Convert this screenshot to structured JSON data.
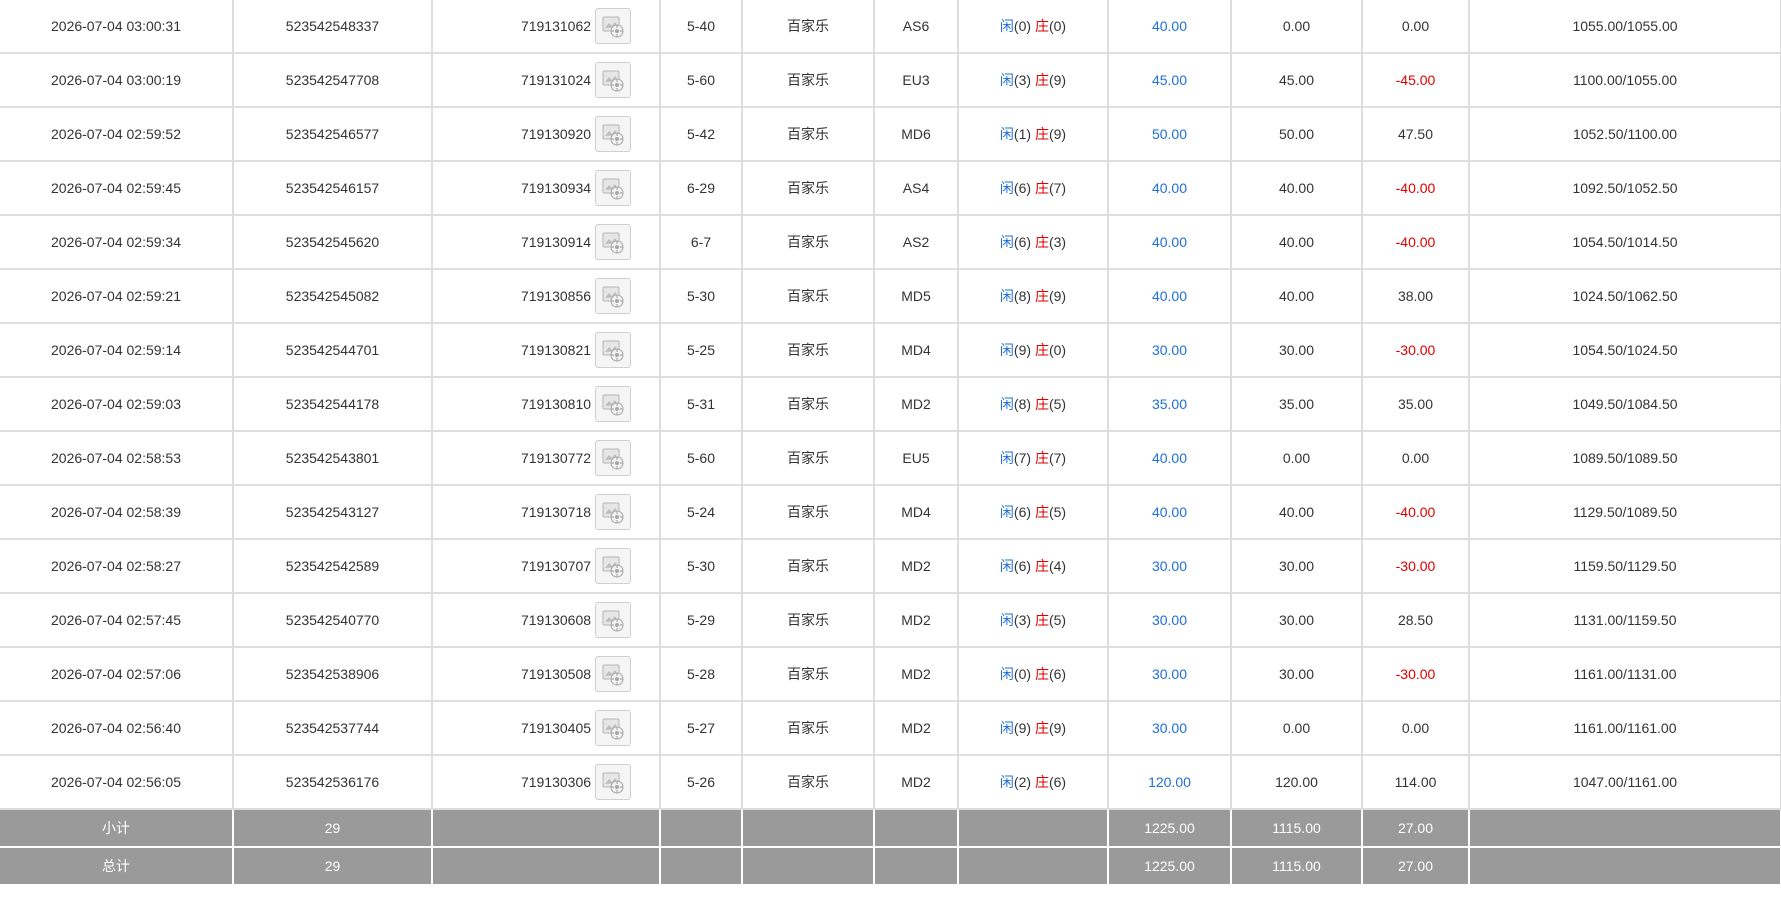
{
  "icons": {
    "row_thumb": "game-replay-image-icon"
  },
  "colors": {
    "blue": "#1e6fd9",
    "red": "#e00000",
    "summary_bg": "#9a9a9a",
    "grid": "#dddddd"
  },
  "rows": [
    {
      "time": "2026-07-04 03:00:31",
      "bet_id": "523542548337",
      "round": "719131062",
      "shoe": "5-40",
      "game": "百家乐",
      "table": "AS6",
      "player_label": "闲",
      "player_pts": "(0)",
      "banker_label": "庄",
      "banker_pts": "(0)",
      "bet": "40.00",
      "valid": "0.00",
      "win": "0.00",
      "win_neg": false,
      "balance": "1055.00/1055.00"
    },
    {
      "time": "2026-07-04 03:00:19",
      "bet_id": "523542547708",
      "round": "719131024",
      "shoe": "5-60",
      "game": "百家乐",
      "table": "EU3",
      "player_label": "闲",
      "player_pts": "(3)",
      "banker_label": "庄",
      "banker_pts": "(9)",
      "bet": "45.00",
      "valid": "45.00",
      "win": "-45.00",
      "win_neg": true,
      "balance": "1100.00/1055.00"
    },
    {
      "time": "2026-07-04 02:59:52",
      "bet_id": "523542546577",
      "round": "719130920",
      "shoe": "5-42",
      "game": "百家乐",
      "table": "MD6",
      "player_label": "闲",
      "player_pts": "(1)",
      "banker_label": "庄",
      "banker_pts": "(9)",
      "bet": "50.00",
      "valid": "50.00",
      "win": "47.50",
      "win_neg": false,
      "balance": "1052.50/1100.00"
    },
    {
      "time": "2026-07-04 02:59:45",
      "bet_id": "523542546157",
      "round": "719130934",
      "shoe": "6-29",
      "game": "百家乐",
      "table": "AS4",
      "player_label": "闲",
      "player_pts": "(6)",
      "banker_label": "庄",
      "banker_pts": "(7)",
      "bet": "40.00",
      "valid": "40.00",
      "win": "-40.00",
      "win_neg": true,
      "balance": "1092.50/1052.50"
    },
    {
      "time": "2026-07-04 02:59:34",
      "bet_id": "523542545620",
      "round": "719130914",
      "shoe": "6-7",
      "game": "百家乐",
      "table": "AS2",
      "player_label": "闲",
      "player_pts": "(6)",
      "banker_label": "庄",
      "banker_pts": "(3)",
      "bet": "40.00",
      "valid": "40.00",
      "win": "-40.00",
      "win_neg": true,
      "balance": "1054.50/1014.50"
    },
    {
      "time": "2026-07-04 02:59:21",
      "bet_id": "523542545082",
      "round": "719130856",
      "shoe": "5-30",
      "game": "百家乐",
      "table": "MD5",
      "player_label": "闲",
      "player_pts": "(8)",
      "banker_label": "庄",
      "banker_pts": "(9)",
      "bet": "40.00",
      "valid": "40.00",
      "win": "38.00",
      "win_neg": false,
      "balance": "1024.50/1062.50"
    },
    {
      "time": "2026-07-04 02:59:14",
      "bet_id": "523542544701",
      "round": "719130821",
      "shoe": "5-25",
      "game": "百家乐",
      "table": "MD4",
      "player_label": "闲",
      "player_pts": "(9)",
      "banker_label": "庄",
      "banker_pts": "(0)",
      "bet": "30.00",
      "valid": "30.00",
      "win": "-30.00",
      "win_neg": true,
      "balance": "1054.50/1024.50"
    },
    {
      "time": "2026-07-04 02:59:03",
      "bet_id": "523542544178",
      "round": "719130810",
      "shoe": "5-31",
      "game": "百家乐",
      "table": "MD2",
      "player_label": "闲",
      "player_pts": "(8)",
      "banker_label": "庄",
      "banker_pts": "(5)",
      "bet": "35.00",
      "valid": "35.00",
      "win": "35.00",
      "win_neg": false,
      "balance": "1049.50/1084.50"
    },
    {
      "time": "2026-07-04 02:58:53",
      "bet_id": "523542543801",
      "round": "719130772",
      "shoe": "5-60",
      "game": "百家乐",
      "table": "EU5",
      "player_label": "闲",
      "player_pts": "(7)",
      "banker_label": "庄",
      "banker_pts": "(7)",
      "bet": "40.00",
      "valid": "0.00",
      "win": "0.00",
      "win_neg": false,
      "balance": "1089.50/1089.50"
    },
    {
      "time": "2026-07-04 02:58:39",
      "bet_id": "523542543127",
      "round": "719130718",
      "shoe": "5-24",
      "game": "百家乐",
      "table": "MD4",
      "player_label": "闲",
      "player_pts": "(6)",
      "banker_label": "庄",
      "banker_pts": "(5)",
      "bet": "40.00",
      "valid": "40.00",
      "win": "-40.00",
      "win_neg": true,
      "balance": "1129.50/1089.50"
    },
    {
      "time": "2026-07-04 02:58:27",
      "bet_id": "523542542589",
      "round": "719130707",
      "shoe": "5-30",
      "game": "百家乐",
      "table": "MD2",
      "player_label": "闲",
      "player_pts": "(6)",
      "banker_label": "庄",
      "banker_pts": "(4)",
      "bet": "30.00",
      "valid": "30.00",
      "win": "-30.00",
      "win_neg": true,
      "balance": "1159.50/1129.50"
    },
    {
      "time": "2026-07-04 02:57:45",
      "bet_id": "523542540770",
      "round": "719130608",
      "shoe": "5-29",
      "game": "百家乐",
      "table": "MD2",
      "player_label": "闲",
      "player_pts": "(3)",
      "banker_label": "庄",
      "banker_pts": "(5)",
      "bet": "30.00",
      "valid": "30.00",
      "win": "28.50",
      "win_neg": false,
      "balance": "1131.00/1159.50"
    },
    {
      "time": "2026-07-04 02:57:06",
      "bet_id": "523542538906",
      "round": "719130508",
      "shoe": "5-28",
      "game": "百家乐",
      "table": "MD2",
      "player_label": "闲",
      "player_pts": "(0)",
      "banker_label": "庄",
      "banker_pts": "(6)",
      "bet": "30.00",
      "valid": "30.00",
      "win": "-30.00",
      "win_neg": true,
      "balance": "1161.00/1131.00"
    },
    {
      "time": "2026-07-04 02:56:40",
      "bet_id": "523542537744",
      "round": "719130405",
      "shoe": "5-27",
      "game": "百家乐",
      "table": "MD2",
      "player_label": "闲",
      "player_pts": "(9)",
      "banker_label": "庄",
      "banker_pts": "(9)",
      "bet": "30.00",
      "valid": "0.00",
      "win": "0.00",
      "win_neg": false,
      "balance": "1161.00/1161.00"
    },
    {
      "time": "2026-07-04 02:56:05",
      "bet_id": "523542536176",
      "round": "719130306",
      "shoe": "5-26",
      "game": "百家乐",
      "table": "MD2",
      "player_label": "闲",
      "player_pts": "(2)",
      "banker_label": "庄",
      "banker_pts": "(6)",
      "bet": "120.00",
      "valid": "120.00",
      "win": "114.00",
      "win_neg": false,
      "balance": "1047.00/1161.00"
    }
  ],
  "summary": [
    {
      "label": "小计",
      "count": "29",
      "bet": "1225.00",
      "valid": "1115.00",
      "win": "27.00"
    },
    {
      "label": "总计",
      "count": "29",
      "bet": "1225.00",
      "valid": "1115.00",
      "win": "27.00"
    }
  ]
}
